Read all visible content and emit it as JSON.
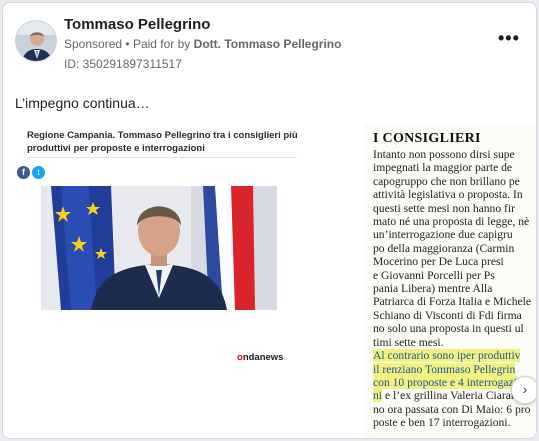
{
  "post": {
    "author": "Tommaso Pellegrino",
    "sponsored_label": "Sponsored",
    "separator": "•",
    "paid_for_label": "Paid for by",
    "payer": "Dott. Tommaso Pellegrino",
    "id_text": "ID: 350291897311517",
    "more_label": "•••",
    "text": "L’impegno continua…"
  },
  "carousel": {
    "card1": {
      "headline": "Regione Campania. Tommaso Pellegrino tra i consiglieri più produttivi per proposte e interrogazioni",
      "facebook_icon": "f",
      "twitter_icon": "t",
      "brand_prefix": "o",
      "brand_rest": "ndanews"
    },
    "card2": {
      "title": "I CONSIGLIERI",
      "lines": [
        "Intanto non possono dirsi supe",
        "impegnati la maggior parte de",
        "capogruppo che non brillano pe",
        "attività legislativa o proposta. In",
        "questi sette mesi non hanno fir",
        "mato né una proposta di legge, nè",
        "un’interrogazione due capigru",
        "po della maggioranza (Carmin",
        "Mocerino per De Luca presi",
        "e Giovanni Porcelli per Ps",
        "pania Libera) mentre Alla",
        "Patriarca di Forza Italia e Michele",
        "Schiano di Visconti di Fdi firma",
        "no solo una proposta in questi ul",
        "timi sette mesi."
      ],
      "highlight_lines": [
        "Al contrario sono iper produttiv",
        "il renziano Tommaso Pellegrin",
        "con 10 proposte e 4 interrogazi",
        "ni"
      ],
      "after_highlight": "e l’ex grillina Valeria Ciarambi",
      "tail_lines": [
        "no ora passata con Di Maio: 6 pro",
        "poste e ben 17 interrogazioni."
      ]
    },
    "next_label": "›"
  }
}
